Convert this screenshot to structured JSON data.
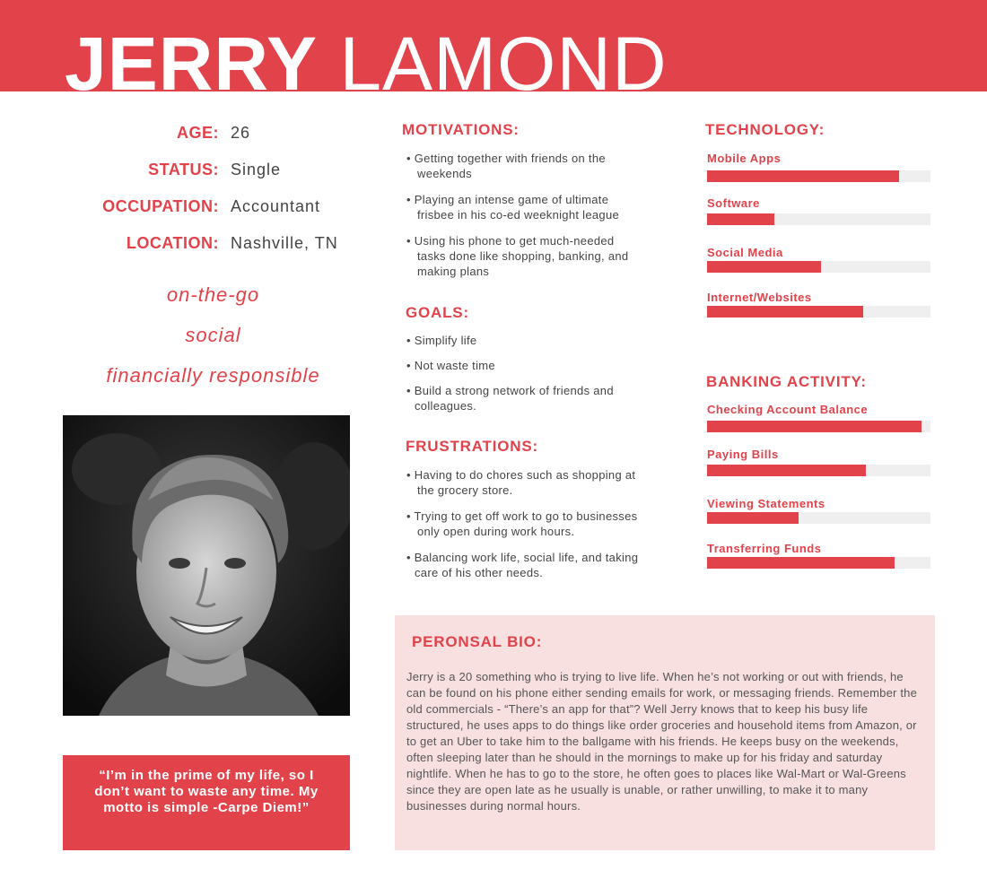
{
  "name": {
    "first": "JERRY",
    "last": "LAMOND"
  },
  "profile": [
    {
      "label": "AGE:",
      "value": "26"
    },
    {
      "label": "STATUS:",
      "value": "Single"
    },
    {
      "label": "OCCUPATION:",
      "value": "Accountant"
    },
    {
      "label": "LOCATION:",
      "value": "Nashville, TN"
    }
  ],
  "traits": [
    "on-the-go",
    "social",
    "financially responsible"
  ],
  "quote": "“I’m in the prime of my life, so I don’t want to waste any time. My motto is simple -Carpe Diem!”",
  "motivations": {
    "title": "MOTIVATIONS:",
    "items": [
      {
        "line1": "• Getting together with friends on the",
        "line2": "weekends"
      },
      {
        "line1": "• Playing an intense game of ultimate",
        "line2": "frisbee in his co-ed weeknight league"
      },
      {
        "line1": "• Using his phone to get much-needed",
        "line2": "tasks done like shopping, banking, and",
        "line3": "making plans"
      }
    ]
  },
  "goals": {
    "title": "GOALS:",
    "items": [
      {
        "line1": "• Simplify life"
      },
      {
        "line1": "• Not waste time"
      },
      {
        "line1": "• Build a strong network of friends and",
        "line2": "colleagues."
      }
    ]
  },
  "frustrations": {
    "title": "FRUSTRATIONS:",
    "items": [
      {
        "line1": "• Having to do chores such as shopping at",
        "line2": "the grocery store."
      },
      {
        "line1": "• Trying to get off work to go to businesses",
        "line2": "only open during work hours."
      },
      {
        "line1": "• Balancing work life, social life, and taking",
        "line2": "care of his other needs."
      }
    ]
  },
  "technology": {
    "title": "TECHNOLOGY:",
    "bars": [
      {
        "label": "Mobile Apps",
        "level": 0.86
      },
      {
        "label": "Software",
        "level": 0.3
      },
      {
        "label": "Social Media",
        "level": 0.51
      },
      {
        "label": "Internet/Websites",
        "level": 0.7
      }
    ]
  },
  "banking": {
    "title": "BANKING ACTIVITY:",
    "bars": [
      {
        "label": "Checking Account Balance",
        "level": 0.96
      },
      {
        "label": "Paying Bills",
        "level": 0.71
      },
      {
        "label": "Viewing Statements",
        "level": 0.41
      },
      {
        "label": "Transferring Funds",
        "level": 0.84
      }
    ]
  },
  "bio": {
    "title": "PERONSAL BIO:",
    "text": "Jerry is a 20 something who is trying to live life.  When he’s not working or out with friends, he can be found on his phone either sending emails for work, or messaging friends.  Remember the old commercials - “There’s an app for that”?  Well Jerry knows that to keep his busy life structured, he uses apps to do things like order groceries and household items from Amazon, or to get an Uber to take him to the ballgame with his friends.  He keeps busy on the weekends, often sleeping later than he should in the mornings to make up for his friday and saturday nightlife.  When he has to go to the store, he often goes to places like Wal-Mart or Wal-Greens since they are open late as he usually is unable, or rather unwilling, to make it to many businesses during normal hours."
  },
  "colors": {
    "accent": "#e2424a",
    "bio_bg": "#f8dfe0",
    "track": "#efefef"
  }
}
